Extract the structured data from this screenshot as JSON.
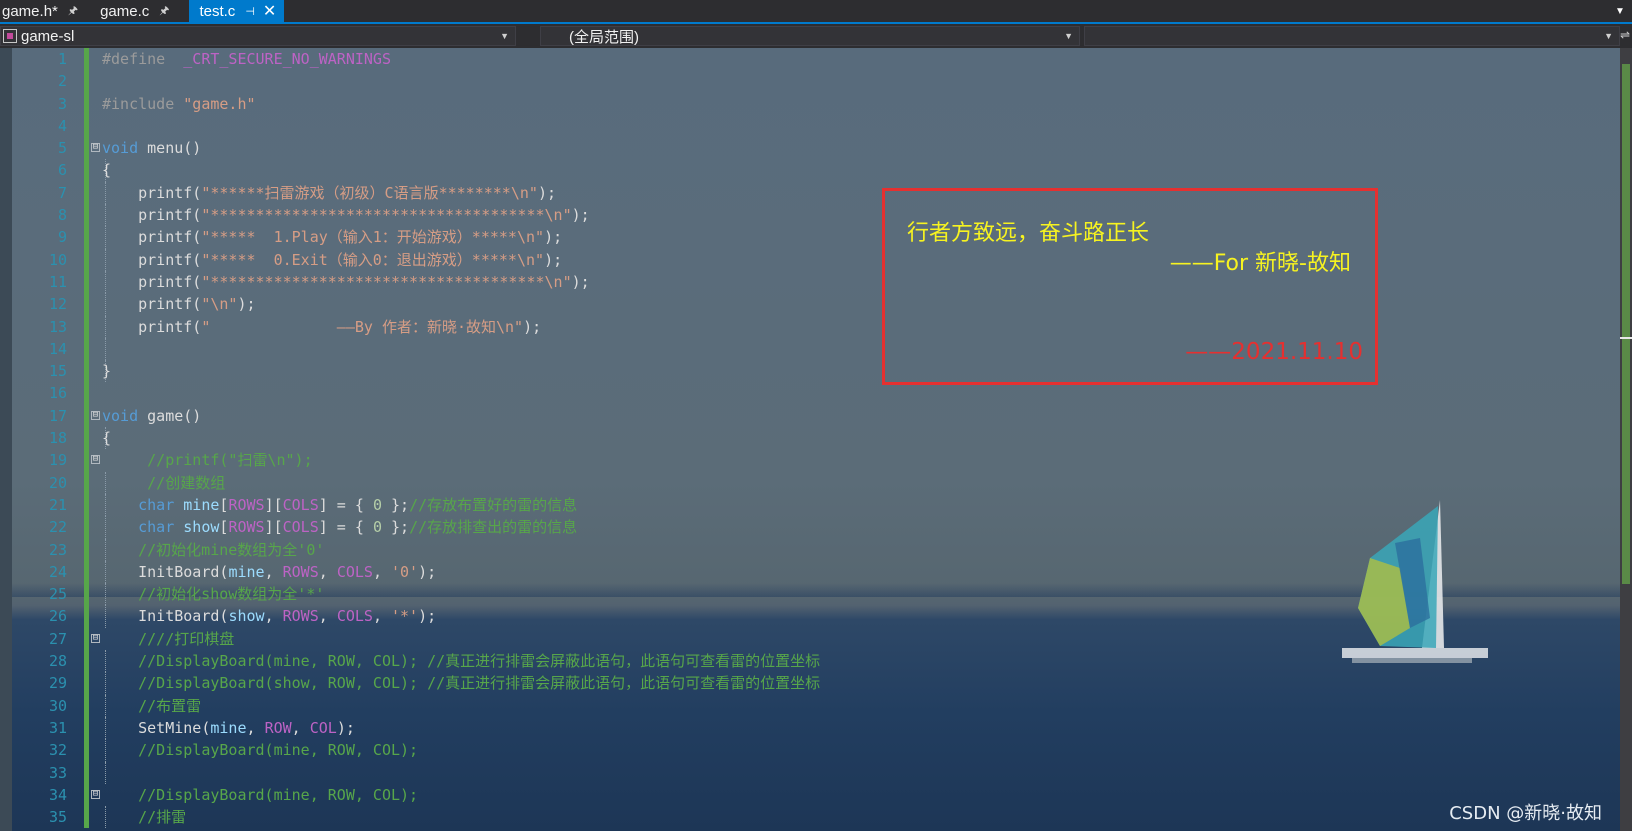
{
  "tabs": [
    {
      "label": "game.h*",
      "pin": "🖈",
      "active": false
    },
    {
      "label": "game.c",
      "pin": "🖈",
      "active": false
    },
    {
      "label": "test.c",
      "pin": "⊣",
      "close": "✕",
      "active": true
    }
  ],
  "navbar": {
    "project": "game-sl",
    "scope": "(全局范围)",
    "member": ""
  },
  "note": {
    "line1": "行者方致远，奋斗路正长",
    "line2": "——For 新晓-故知",
    "date": "——2021.11.10"
  },
  "watermark": "CSDN @新晓·故知",
  "colors": {
    "accent": "#007acc",
    "change_bar": "#57a64a",
    "note_border": "#e53030",
    "note_text": "#f7f320"
  },
  "lines": [
    {
      "n": "1",
      "fold": "",
      "segs": [
        [
          "pp",
          "#define  "
        ],
        [
          "mac",
          "_CRT_SECURE_NO_WARNINGS"
        ]
      ]
    },
    {
      "n": "2",
      "fold": "",
      "segs": []
    },
    {
      "n": "3",
      "fold": "",
      "segs": [
        [
          "pp",
          "#include "
        ],
        [
          "str",
          "\"game.h\""
        ]
      ]
    },
    {
      "n": "4",
      "fold": "",
      "segs": []
    },
    {
      "n": "5",
      "fold": "⊟",
      "segs": [
        [
          "kw",
          "void"
        ],
        [
          "id",
          " menu()"
        ]
      ]
    },
    {
      "n": "6",
      "fold": "",
      "segs": [
        [
          "id",
          "{"
        ]
      ]
    },
    {
      "n": "7",
      "fold": "",
      "segs": [
        [
          "id",
          "    printf("
        ],
        [
          "str",
          "\"******扫雷游戏（初级）C语言版********\\n\""
        ],
        [
          "id",
          ");"
        ]
      ]
    },
    {
      "n": "8",
      "fold": "",
      "segs": [
        [
          "id",
          "    printf("
        ],
        [
          "str",
          "\"*************************************\\n\""
        ],
        [
          "id",
          ");"
        ]
      ]
    },
    {
      "n": "9",
      "fold": "",
      "segs": [
        [
          "id",
          "    printf("
        ],
        [
          "str",
          "\"*****  1.Play（输入1：开始游戏）*****\\n\""
        ],
        [
          "id",
          ");"
        ]
      ]
    },
    {
      "n": "10",
      "fold": "",
      "segs": [
        [
          "id",
          "    printf("
        ],
        [
          "str",
          "\"*****  0.Exit（输入0：退出游戏）*****\\n\""
        ],
        [
          "id",
          ");"
        ]
      ]
    },
    {
      "n": "11",
      "fold": "",
      "segs": [
        [
          "id",
          "    printf("
        ],
        [
          "str",
          "\"*************************************\\n\""
        ],
        [
          "id",
          ");"
        ]
      ]
    },
    {
      "n": "12",
      "fold": "",
      "segs": [
        [
          "id",
          "    printf("
        ],
        [
          "str",
          "\"\\n\""
        ],
        [
          "id",
          ");"
        ]
      ]
    },
    {
      "n": "13",
      "fold": "",
      "segs": [
        [
          "id",
          "    printf("
        ],
        [
          "str",
          "\"              ——By 作者：新晓·故知\\n\""
        ],
        [
          "id",
          ");"
        ]
      ]
    },
    {
      "n": "14",
      "fold": "",
      "segs": []
    },
    {
      "n": "15",
      "fold": "",
      "segs": [
        [
          "id",
          "}"
        ]
      ]
    },
    {
      "n": "16",
      "fold": "",
      "segs": []
    },
    {
      "n": "17",
      "fold": "⊟",
      "segs": [
        [
          "kw",
          "void"
        ],
        [
          "id",
          " game()"
        ]
      ]
    },
    {
      "n": "18",
      "fold": "",
      "segs": [
        [
          "id",
          "{"
        ]
      ]
    },
    {
      "n": "19",
      "fold": "⊟",
      "segs": [
        [
          "cm",
          "     //printf(\"扫雷\\n\");"
        ]
      ]
    },
    {
      "n": "20",
      "fold": "",
      "segs": [
        [
          "cm",
          "     //创建数组"
        ]
      ]
    },
    {
      "n": "21",
      "fold": "",
      "segs": [
        [
          "kw",
          "    char"
        ],
        [
          "var",
          " mine"
        ],
        [
          "id",
          "["
        ],
        [
          "mac",
          "ROWS"
        ],
        [
          "id",
          "]["
        ],
        [
          "mac",
          "COLS"
        ],
        [
          "id",
          "] = { "
        ],
        [
          "num",
          "0"
        ],
        [
          "id",
          " };"
        ],
        [
          "cm",
          "//存放布置好的雷的信息"
        ]
      ]
    },
    {
      "n": "22",
      "fold": "",
      "segs": [
        [
          "kw",
          "    char"
        ],
        [
          "var",
          " show"
        ],
        [
          "id",
          "["
        ],
        [
          "mac",
          "ROWS"
        ],
        [
          "id",
          "]["
        ],
        [
          "mac",
          "COLS"
        ],
        [
          "id",
          "] = { "
        ],
        [
          "num",
          "0"
        ],
        [
          "id",
          " };"
        ],
        [
          "cm",
          "//存放排查出的雷的信息"
        ]
      ]
    },
    {
      "n": "23",
      "fold": "",
      "segs": [
        [
          "cm",
          "    //初始化mine数组为全'0'"
        ]
      ]
    },
    {
      "n": "24",
      "fold": "",
      "segs": [
        [
          "id",
          "    InitBoard("
        ],
        [
          "var",
          "mine"
        ],
        [
          "id",
          ", "
        ],
        [
          "mac",
          "ROWS"
        ],
        [
          "id",
          ", "
        ],
        [
          "mac",
          "COLS"
        ],
        [
          "id",
          ", "
        ],
        [
          "str",
          "'0'"
        ],
        [
          "id",
          ");"
        ]
      ]
    },
    {
      "n": "25",
      "fold": "",
      "segs": [
        [
          "cm",
          "    //初始化show数组为全'*'"
        ]
      ]
    },
    {
      "n": "26",
      "fold": "",
      "segs": [
        [
          "id",
          "    InitBoard("
        ],
        [
          "var",
          "show"
        ],
        [
          "id",
          ", "
        ],
        [
          "mac",
          "ROWS"
        ],
        [
          "id",
          ", "
        ],
        [
          "mac",
          "COLS"
        ],
        [
          "id",
          ", "
        ],
        [
          "str",
          "'*'"
        ],
        [
          "id",
          ");"
        ]
      ]
    },
    {
      "n": "27",
      "fold": "⊟",
      "segs": [
        [
          "cm",
          "    ////打印棋盘"
        ]
      ]
    },
    {
      "n": "28",
      "fold": "",
      "segs": [
        [
          "cm",
          "    //DisplayBoard(mine, ROW, COL); //真正进行排雷会屏蔽此语句，此语句可查看雷的位置坐标"
        ]
      ]
    },
    {
      "n": "29",
      "fold": "",
      "segs": [
        [
          "cm",
          "    //DisplayBoard(show, ROW, COL); //真正进行排雷会屏蔽此语句，此语句可查看雷的位置坐标"
        ]
      ]
    },
    {
      "n": "30",
      "fold": "",
      "segs": [
        [
          "cm",
          "    //布置雷"
        ]
      ]
    },
    {
      "n": "31",
      "fold": "",
      "segs": [
        [
          "id",
          "    SetMine("
        ],
        [
          "var",
          "mine"
        ],
        [
          "id",
          ", "
        ],
        [
          "mac",
          "ROW"
        ],
        [
          "id",
          ", "
        ],
        [
          "mac",
          "COL"
        ],
        [
          "id",
          ");"
        ]
      ]
    },
    {
      "n": "32",
      "fold": "",
      "segs": [
        [
          "cm",
          "    //DisplayBoard(mine, ROW, COL);"
        ]
      ]
    },
    {
      "n": "33",
      "fold": "",
      "segs": []
    },
    {
      "n": "34",
      "fold": "⊟",
      "segs": [
        [
          "cm",
          "    //DisplayBoard(mine, ROW, COL);"
        ]
      ]
    },
    {
      "n": "35",
      "fold": "",
      "segs": [
        [
          "cm",
          "    //排雷"
        ]
      ]
    }
  ]
}
